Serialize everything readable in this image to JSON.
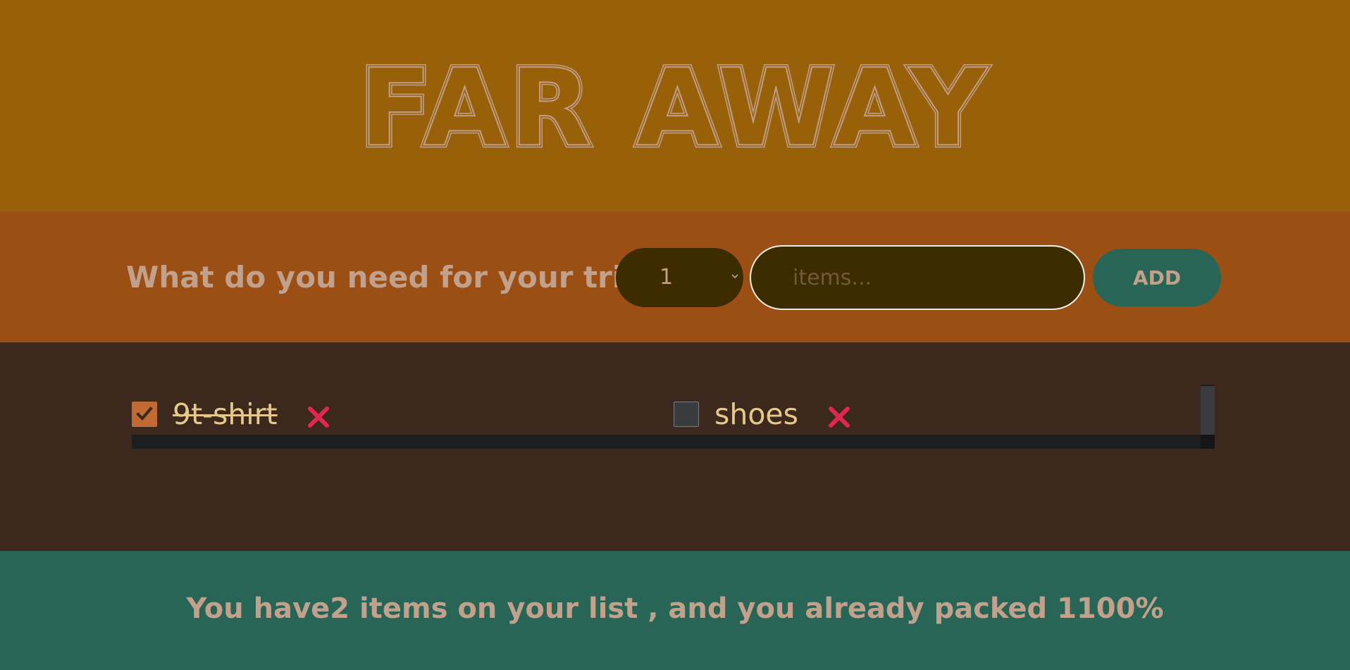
{
  "header": {
    "title": "FAR AWAY"
  },
  "form": {
    "prompt": "What do you need for your trip",
    "quantity_value": "1",
    "item_placeholder": "items...",
    "item_value": "",
    "add_label": "ADD"
  },
  "list": {
    "items": [
      {
        "label": "9t-shirt",
        "packed": true
      },
      {
        "label": "shoes",
        "packed": false
      }
    ]
  },
  "stats": {
    "text": "You have2 items on your list , and you already packed 1100%"
  },
  "colors": {
    "header_bg": "#99600a",
    "form_bg": "#9b4f14",
    "list_bg": "#3c281c",
    "stats_bg": "#286556",
    "accent_red": "#e0274f",
    "checkbox_checked": "#c16a33",
    "item_text": "#e6c98a",
    "muted_text": "#c1a18c"
  },
  "icons": {
    "checkbox_checked": "checkmark-icon",
    "delete": "close-x-icon",
    "select": "chevron-down-icon"
  }
}
